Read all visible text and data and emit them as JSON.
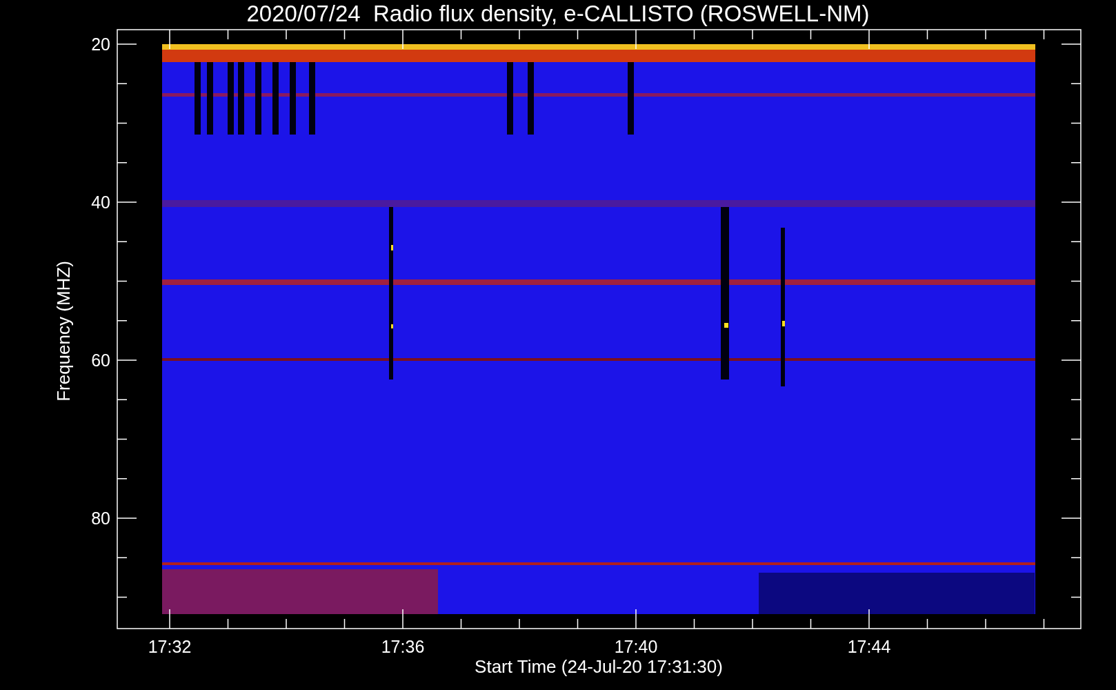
{
  "title": "2020/07/24  Radio flux density, e-CALLISTO (ROSWELL-NM)",
  "plot": {
    "ylabel": "Frequency (MHZ)",
    "xlabel": "Start Time (24-Jul-20 17:31:30)",
    "yticks": [
      "20",
      "40",
      "60",
      "80"
    ],
    "xticks": [
      "17:32",
      "17:36",
      "17:40",
      "17:44"
    ]
  }
}
